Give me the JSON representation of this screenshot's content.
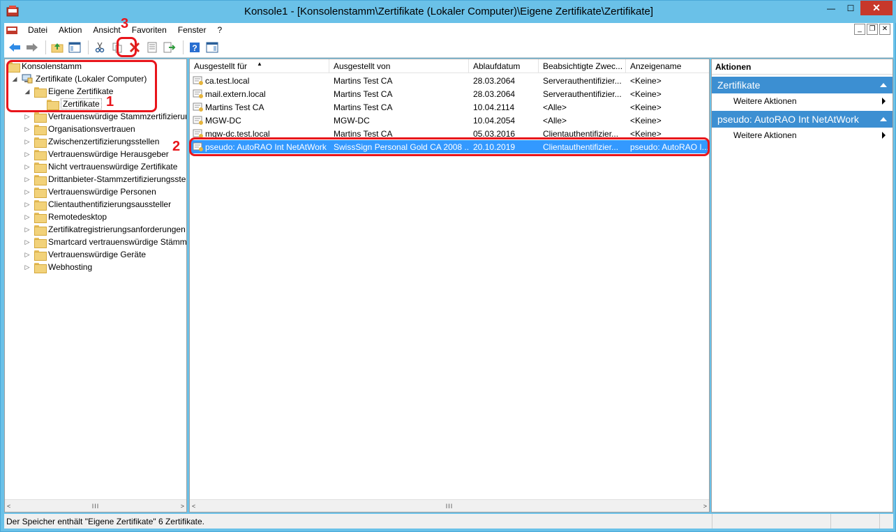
{
  "window": {
    "title": "Konsole1 - [Konsolenstamm\\Zertifikate (Lokaler Computer)\\Eigene Zertifikate\\Zertifikate]",
    "minimize": "—",
    "maximize": "☐",
    "close": "✕"
  },
  "menu": {
    "items": [
      "Datei",
      "Aktion",
      "Ansicht",
      "Favoriten",
      "Fenster",
      "?"
    ]
  },
  "tree": {
    "root": "Konsolenstamm",
    "computer": "Zertifikate (Lokaler Computer)",
    "eigene": "Eigene Zertifikate",
    "zertifikate": "Zertifikate",
    "folders": [
      "Vertrauenswürdige Stammzertifizierungsstellen",
      "Organisationsvertrauen",
      "Zwischenzertifizierungsstellen",
      "Vertrauenswürdige Herausgeber",
      "Nicht vertrauenswürdige Zertifikate",
      "Drittanbieter-Stammzertifizierungsstellen",
      "Vertrauenswürdige Personen",
      "Clientauthentifizierungsaussteller",
      "Remotedesktop",
      "Zertifikatregistrierungsanforderungen",
      "Smartcard vertrauenswürdige Stämme",
      "Vertrauenswürdige Geräte",
      "Webhosting"
    ]
  },
  "list": {
    "columns": [
      "Ausgestellt für",
      "Ausgestellt von",
      "Ablaufdatum",
      "Beabsichtigte Zwec...",
      "Anzeigename"
    ],
    "rows": [
      [
        "ca.test.local",
        "Martins Test CA",
        "28.03.2064",
        "Serverauthentifizier...",
        "<Keine>"
      ],
      [
        "mail.extern.local",
        "Martins Test CA",
        "28.03.2064",
        "Serverauthentifizier...",
        "<Keine>"
      ],
      [
        "Martins Test CA",
        "Martins Test CA",
        "10.04.2114",
        "<Alle>",
        "<Keine>"
      ],
      [
        "MGW-DC",
        "MGW-DC",
        "10.04.2054",
        "<Alle>",
        "<Keine>"
      ],
      [
        "mgw-dc.test.local",
        "Martins Test CA",
        "05.03.2016",
        "Clientauthentifizier...",
        "<Keine>"
      ],
      [
        "pseudo: AutoRAO Int NetAtWork",
        "SwissSign Personal Gold CA 2008 ...",
        "20.10.2019",
        "Clientauthentifizier...",
        "pseudo: AutoRAO I..."
      ]
    ],
    "selected_row": 5
  },
  "actions": {
    "header": "Aktionen",
    "section1": "Zertifikate",
    "section1_item": "Weitere Aktionen",
    "section2": "pseudo: AutoRAO Int NetAtWork",
    "section2_item": "Weitere Aktionen"
  },
  "status": {
    "text": "Der Speicher enthält \"Eigene Zertifikate\" 6 Zertifikate."
  },
  "annotations": [
    "1",
    "2",
    "3"
  ],
  "colors": {
    "titlebar": "#6ac1e8",
    "selection": "#3399ff",
    "action_section": "#3c8fd2",
    "annotation": "#e8151b"
  }
}
